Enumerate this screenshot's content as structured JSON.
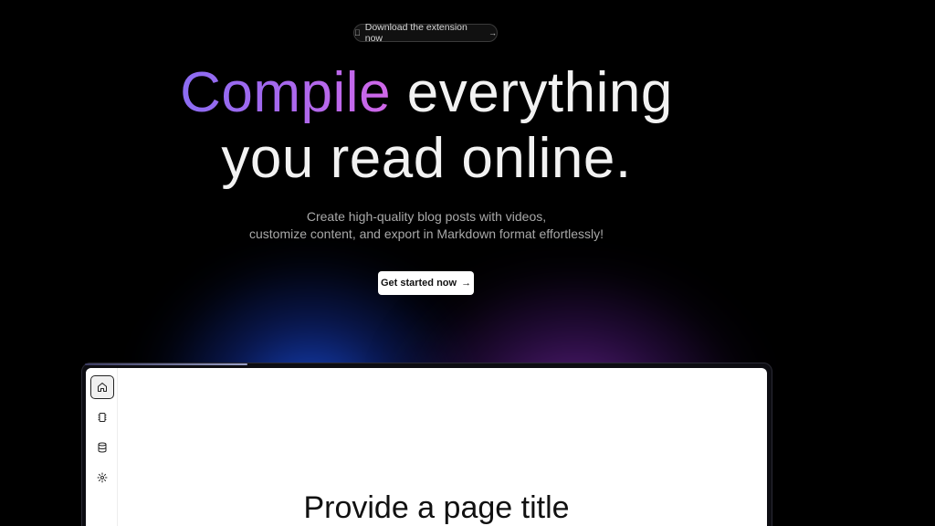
{
  "banner": {
    "label": "Download the extension now",
    "icon": "apple-icon",
    "arrow": "→"
  },
  "hero": {
    "headline_highlight": "Compile",
    "headline_rest_line1": " everything",
    "headline_line2": "you read online.",
    "subtitle_line1": "Create high-quality blog posts with videos,",
    "subtitle_line2": "customize content, and export in Markdown format effortlessly!",
    "cta_label": "Get started now",
    "cta_arrow": "→"
  },
  "app_preview": {
    "progress_fraction": 0.24,
    "sidebar": [
      {
        "name": "home",
        "icon": "home-icon",
        "active": true
      },
      {
        "name": "notebook",
        "icon": "notebook-icon",
        "active": false
      },
      {
        "name": "database",
        "icon": "database-icon",
        "active": false
      },
      {
        "name": "settings",
        "icon": "gear-icon",
        "active": false
      }
    ],
    "page_title": "Provide a page title"
  },
  "colors": {
    "background": "#000000",
    "headline_gradient_start": "#8b6cf2",
    "headline_gradient_end": "#d067e8",
    "glow_blue": "#1950e6",
    "glow_purple": "#7828aa"
  }
}
